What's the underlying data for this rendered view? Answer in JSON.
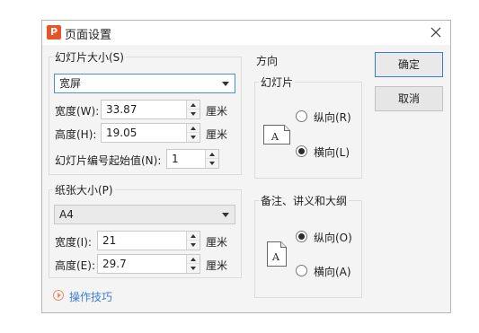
{
  "window": {
    "title": "页面设置",
    "app_icon_glyph": "P",
    "accent_color": "#e8542a"
  },
  "slide_size": {
    "legend": "幻灯片大小(S)",
    "selected": "宽屏",
    "width_label": "宽度(W):",
    "width_value": "33.87",
    "width_unit": "厘米",
    "height_label": "高度(H):",
    "height_value": "19.05",
    "height_unit": "厘米",
    "number_label": "幻灯片编号起始值(N):",
    "number_value": "1"
  },
  "paper_size": {
    "legend": "纸张大小(P)",
    "selected": "A4",
    "width_label": "宽度(I):",
    "width_value": "21",
    "width_unit": "厘米",
    "height_label": "高度(E):",
    "height_value": "29.7",
    "height_unit": "厘米"
  },
  "orientation": {
    "title": "方向",
    "slides": {
      "legend": "幻灯片",
      "icon_letter": "A",
      "portrait_label": "纵向(R)",
      "landscape_label": "横向(L)",
      "selected": "landscape"
    },
    "notes": {
      "legend": "备注、讲义和大纲",
      "icon_letter": "A",
      "portrait_label": "纵向(O)",
      "landscape_label": "横向(A)",
      "selected": "portrait"
    }
  },
  "buttons": {
    "ok": "确定",
    "cancel": "取消"
  },
  "tips": {
    "label": "操作技巧",
    "color": "#3b7dd8"
  }
}
